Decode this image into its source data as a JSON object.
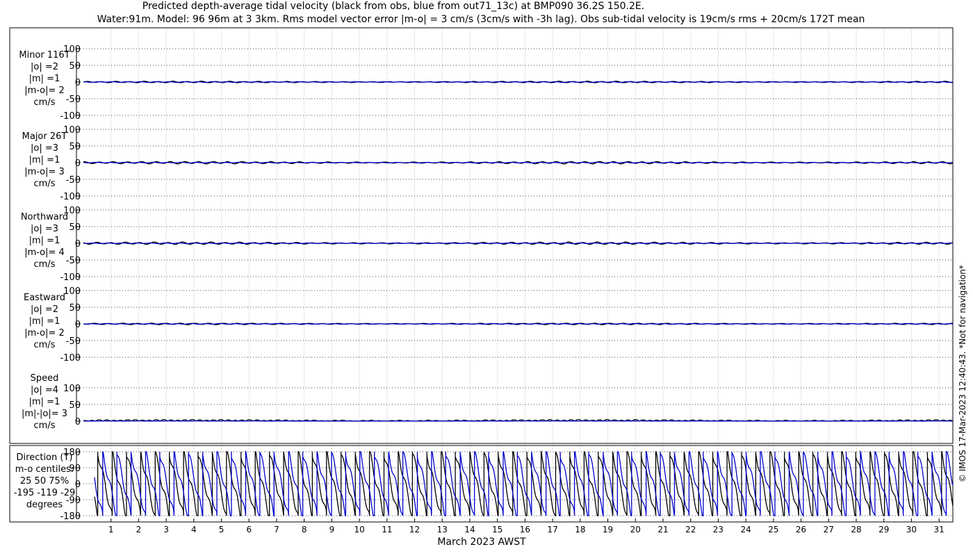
{
  "title_line1": "Predicted depth-average tidal velocity (black from obs, blue from out71_13c) at BMP090 36.2S 150.2E.",
  "title_line2": "Water:91m. Model: 96 96m at 3 3km. Rms model vector error |m-o| = 3 cm/s (3cm/s with -3h lag). Obs sub-tidal velocity is 19cm/s rms + 20cm/s 172T mean",
  "xlabel": "March 2023 AWST",
  "side_note": "© IMOS 17-Mar-2023 12:40:43. *Not for navigation*",
  "colors": {
    "obs": "#000000",
    "model": "#0000cc",
    "grid": "#bbbbbb"
  },
  "chart_data": [
    {
      "type": "line",
      "panel": "minor",
      "labels": [
        "Minor 116T",
        "|o| =2",
        "|m| =1",
        "|m-o|= 2",
        "cm/s"
      ],
      "yticks": [
        "100",
        "50",
        "0",
        "-50",
        "-100"
      ],
      "ylim": [
        -100,
        100
      ],
      "xlim": [
        0,
        31.5
      ],
      "series": [
        {
          "color": "obs",
          "amplitude": 2,
          "form": "tide"
        },
        {
          "color": "model",
          "amplitude": 1,
          "form": "tide"
        }
      ]
    },
    {
      "type": "line",
      "panel": "major",
      "labels": [
        "Major 26T",
        "|o| =3",
        "|m| =1",
        "|m-o|= 3",
        "cm/s"
      ],
      "yticks": [
        "100",
        "50",
        "0",
        "-50",
        "-100"
      ],
      "ylim": [
        -100,
        100
      ],
      "xlim": [
        0,
        31.5
      ],
      "series": [
        {
          "color": "obs",
          "amplitude": 3,
          "form": "tide"
        },
        {
          "color": "model",
          "amplitude": 1,
          "form": "tide"
        }
      ]
    },
    {
      "type": "line",
      "panel": "north",
      "labels": [
        "Northward",
        "|o| =3",
        "|m| =1",
        "|m-o|= 4",
        "cm/s"
      ],
      "yticks": [
        "100",
        "50",
        "0",
        "-50",
        "-100"
      ],
      "ylim": [
        -100,
        100
      ],
      "xlim": [
        0,
        31.5
      ],
      "series": [
        {
          "color": "obs",
          "amplitude": 3,
          "form": "tide"
        },
        {
          "color": "model",
          "amplitude": 1,
          "form": "tide"
        }
      ]
    },
    {
      "type": "line",
      "panel": "east",
      "labels": [
        "Eastward",
        "|o| =2",
        "|m| =1",
        "|m-o|= 2",
        "cm/s"
      ],
      "yticks": [
        "100",
        "50",
        "0",
        "-50",
        "-100"
      ],
      "ylim": [
        -100,
        100
      ],
      "xlim": [
        0,
        31.5
      ],
      "series": [
        {
          "color": "obs",
          "amplitude": 2,
          "form": "tide"
        },
        {
          "color": "model",
          "amplitude": 1,
          "form": "tide"
        }
      ]
    },
    {
      "type": "line",
      "panel": "speed",
      "labels": [
        "Speed",
        "|o| =4",
        "|m| =1",
        "|m|-|o|= 3",
        "cm/s"
      ],
      "yticks": [
        "100",
        "50",
        "0"
      ],
      "ylim": [
        0,
        100
      ],
      "xlim": [
        0,
        31.5
      ],
      "series": [
        {
          "color": "obs",
          "amplitude": 4,
          "form": "speed"
        },
        {
          "color": "model",
          "amplitude": 1,
          "form": "speed"
        }
      ]
    },
    {
      "type": "line",
      "panel": "direction",
      "labels": [
        "Direction (T)",
        "m-o centiles:",
        "25  50  75%",
        "-195 -119  -29",
        "degrees"
      ],
      "yticks": [
        "180",
        "90",
        "0",
        "-90",
        "-180"
      ],
      "ylim": [
        -180,
        180
      ],
      "xlim": [
        0,
        31.5
      ],
      "series": [
        {
          "color": "obs",
          "amplitude": 180,
          "form": "direction",
          "phase_deg": 0
        },
        {
          "color": "model",
          "amplitude": 180,
          "form": "direction",
          "phase_deg": -119
        }
      ]
    }
  ],
  "xticks": [
    "1",
    "2",
    "3",
    "4",
    "5",
    "6",
    "7",
    "8",
    "9",
    "10",
    "11",
    "12",
    "13",
    "14",
    "15",
    "16",
    "17",
    "18",
    "19",
    "20",
    "21",
    "22",
    "23",
    "24",
    "25",
    "26",
    "27",
    "28",
    "29",
    "30",
    "31"
  ]
}
